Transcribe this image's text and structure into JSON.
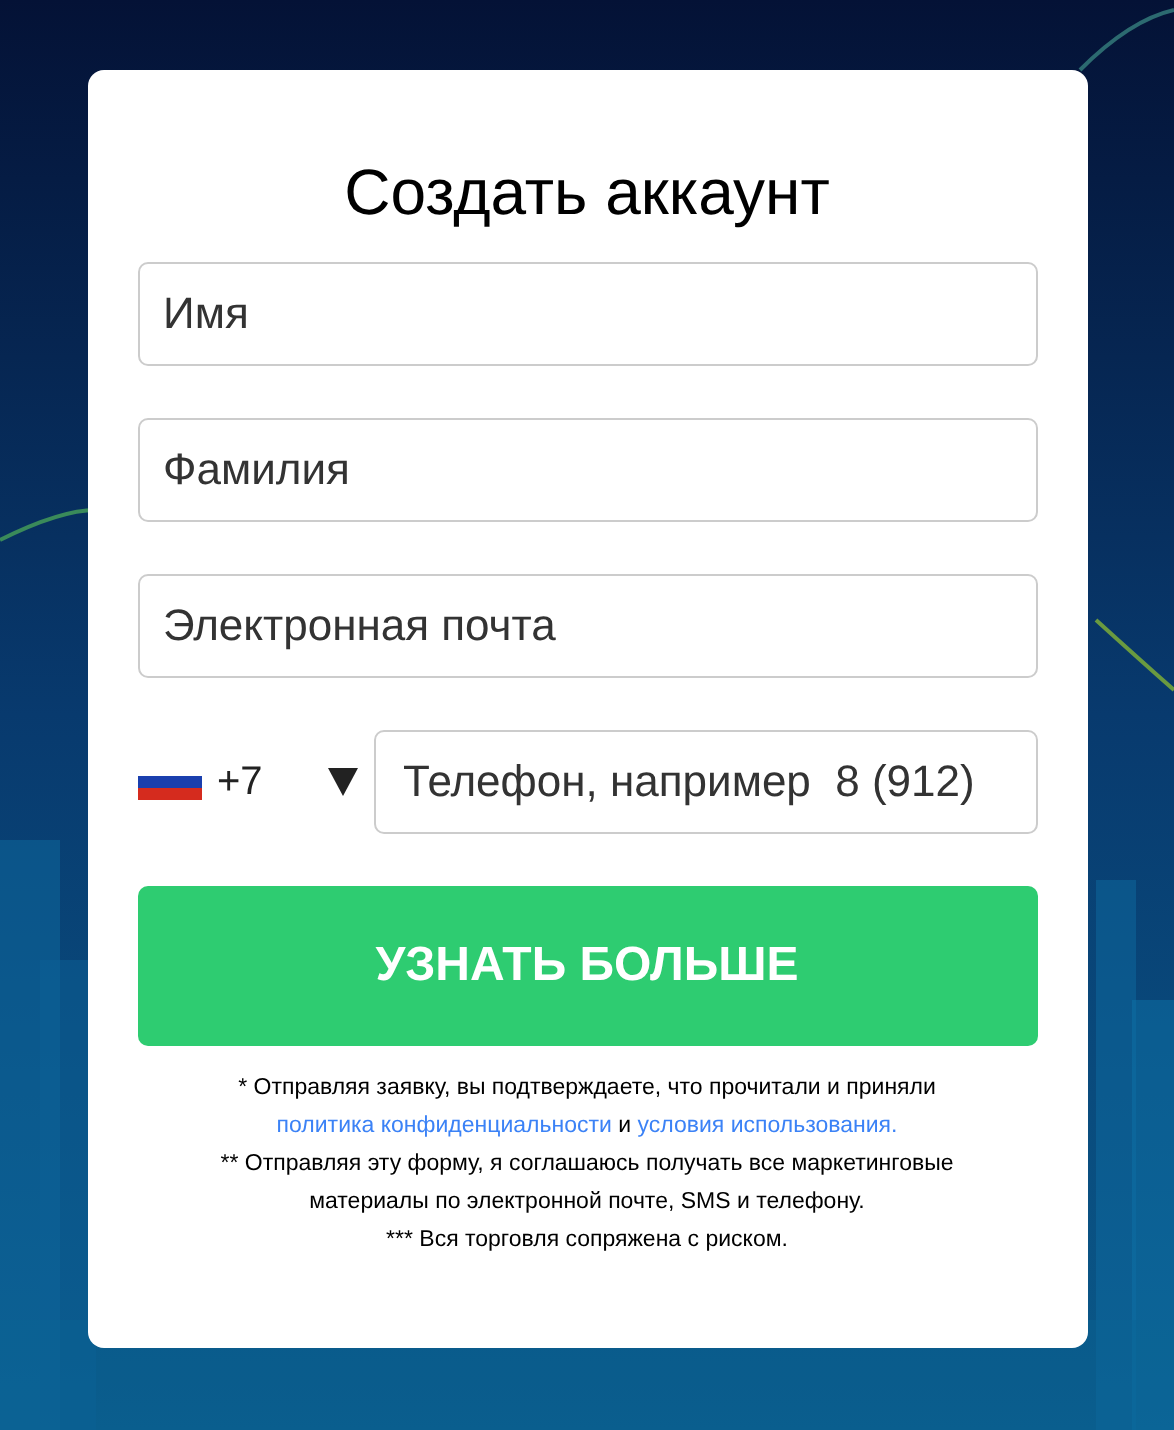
{
  "form": {
    "title": "Создать аккаунт",
    "fields": [
      {
        "placeholder": "Имя"
      },
      {
        "placeholder": "Фамилия"
      },
      {
        "placeholder": "Электронная почта"
      }
    ],
    "phone": {
      "country_code": "+7",
      "placeholder": "Телефон, например  8 (912)"
    },
    "submit": "УЗНАТЬ БОЛЬШЕ",
    "consent": {
      "text": "* Отправляя заявку, вы подтверждаете, что прочитали и приняли",
      "privacy_link": "политика конфиденциальности",
      "joiner": "и",
      "terms_link": "условия использования."
    },
    "notes": [
      "** Отправляя эту форму, я соглашаюсь получать все маркетинговые материалы по электронной почте, SMS и телефону.",
      "*** Вся торговля сопряжена с риском."
    ]
  }
}
